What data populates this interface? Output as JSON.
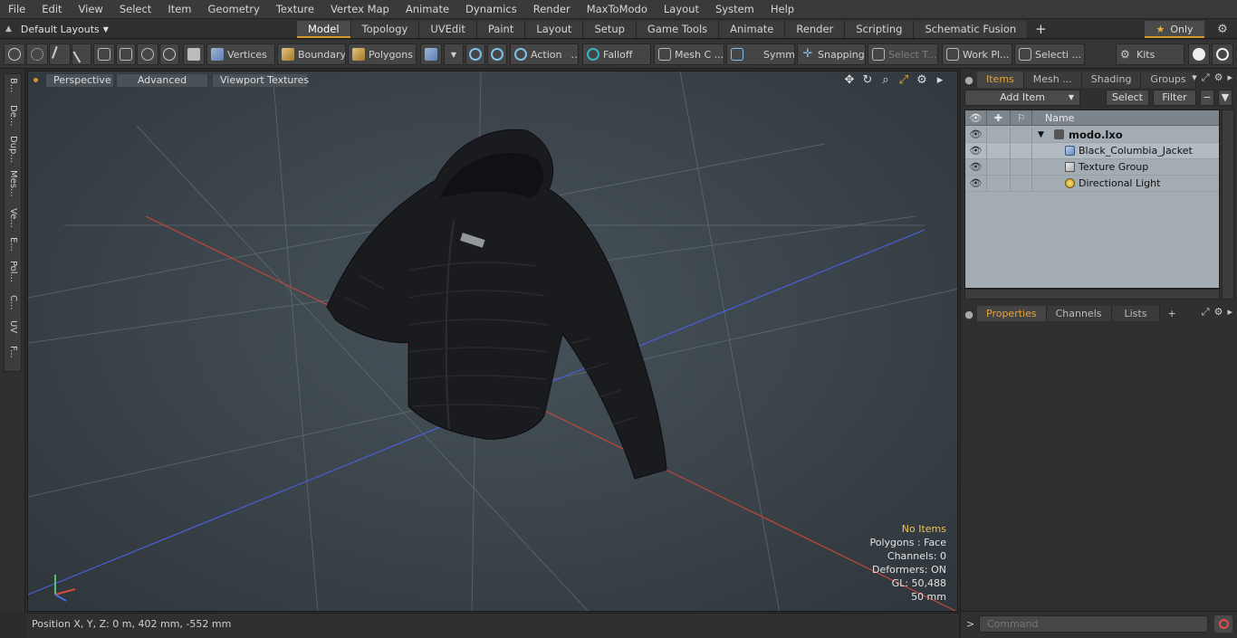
{
  "menu": [
    "File",
    "Edit",
    "View",
    "Select",
    "Item",
    "Geometry",
    "Texture",
    "Vertex Map",
    "Animate",
    "Dynamics",
    "Render",
    "MaxToModo",
    "Layout",
    "System",
    "Help"
  ],
  "layout_selector": "Default Layouts",
  "tabs": [
    {
      "label": "Model",
      "active": true
    },
    {
      "label": "Topology"
    },
    {
      "label": "UVEdit"
    },
    {
      "label": "Paint"
    },
    {
      "label": "Layout"
    },
    {
      "label": "Setup"
    },
    {
      "label": "Game Tools"
    },
    {
      "label": "Animate"
    },
    {
      "label": "Render"
    },
    {
      "label": "Scripting"
    },
    {
      "label": "Schematic Fusion"
    }
  ],
  "only_label": "Only",
  "toolbar": {
    "vertices": "Vertices",
    "boundary": "Boundary",
    "polygons": "Polygons",
    "action": "Action",
    "falloff": "Falloff",
    "mesh_c": "Mesh C ...",
    "symm": "Symm ...",
    "snapping": "Snapping",
    "select_t": "Select T...",
    "work_pl": "Work Pl...",
    "selecti": "Selecti ...",
    "kits": "Kits"
  },
  "left_tabs": [
    "B...",
    "De...",
    "Dup...",
    "Mes...",
    "Ve...",
    "E...",
    "Pol...",
    "C...",
    "UV",
    "F..."
  ],
  "viewport": {
    "perspective": "Perspective",
    "advanced": "Advanced",
    "textures": "Viewport Textures",
    "info": {
      "selection": "No Items",
      "polygons": "Polygons : Face",
      "channels": "Channels: 0",
      "deformers": "Deformers: ON",
      "gl": "GL: 50,488",
      "scale": "50 mm"
    }
  },
  "status": {
    "position": "Position X, Y, Z:   0 m, 402 mm, -552 mm"
  },
  "items_panel": {
    "tabs": [
      "Items",
      "Mesh ...",
      "Shading",
      "Groups"
    ],
    "add_item": "Add Item",
    "select": "Select",
    "filter": "Filter",
    "name_header": "Name",
    "tree": [
      {
        "label": "modo.lxo",
        "icon": "scene-icon",
        "depth": 0
      },
      {
        "label": "Black_Columbia_Jacket",
        "icon": "mesh-icon",
        "depth": 1
      },
      {
        "label": "Texture Group",
        "icon": "texture-group-icon",
        "depth": 1
      },
      {
        "label": "Directional Light",
        "icon": "light-icon",
        "depth": 1
      }
    ]
  },
  "props_panel": {
    "tabs": [
      "Properties",
      "Channels",
      "Lists"
    ]
  },
  "command": {
    "placeholder": "Command"
  }
}
